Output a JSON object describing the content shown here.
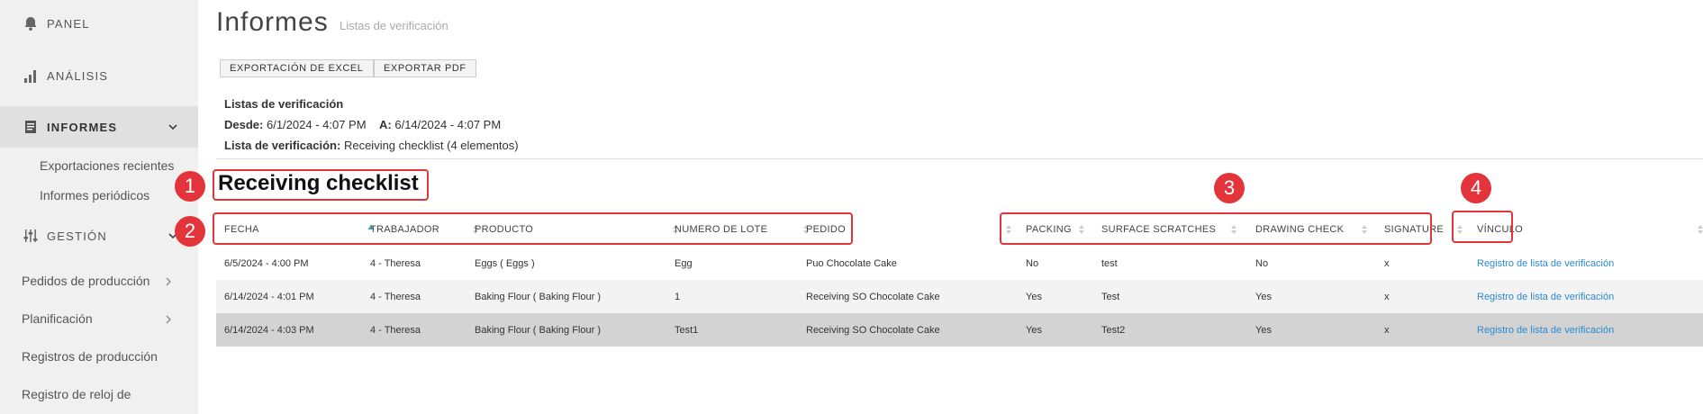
{
  "sidebar": {
    "nav": {
      "panel": "PANEL",
      "analisis": "ANÁLISIS",
      "informes": "INFORMES",
      "gestion": "GESTIÓN"
    },
    "informes_sub": [
      "Exportaciones recientes",
      "Informes periódicos"
    ],
    "gestion_sub": [
      "Pedidos de producción",
      "Planificación",
      "Registros de producción",
      "Registro de reloj de"
    ]
  },
  "header": {
    "title": "Informes",
    "subtitle": "Listas de verificación"
  },
  "toolbar": {
    "excel_label": "EXPORTACIÓN DE EXCEL",
    "pdf_label": "EXPORTAR PDF"
  },
  "report_meta": {
    "heading": "Listas de verificación",
    "desde_label": "Desde:",
    "desde_value": "6/1/2024 - 4:07 PM",
    "a_label": "A:",
    "a_value": "6/14/2024 - 4:07 PM",
    "list_label": "Lista de verificación:",
    "list_value": "Receiving checklist (4 elementos)"
  },
  "section_title": "Receiving checklist",
  "table": {
    "columns": [
      "FECHA",
      "TRABAJADOR",
      "PRODUCTO",
      "NUMERO DE LOTE",
      "PEDIDO",
      "PACKING",
      "SURFACE SCRATCHES",
      "DRAWING CHECK",
      "SIGNATURE",
      "VÍNCULO"
    ],
    "sorted_column": "FECHA",
    "sort_direction": "ascending",
    "rows": [
      [
        "6/5/2024 - 4:00 PM",
        "4 - Theresa",
        "Eggs ( Eggs )",
        "Egg",
        "Puo Chocolate Cake",
        "No",
        "test",
        "No",
        "x",
        "Registro de lista de verificación"
      ],
      [
        "6/14/2024 - 4:01 PM",
        "4 - Theresa",
        "Baking Flour ( Baking Flour )",
        "1",
        "Receiving SO Chocolate Cake",
        "Yes",
        "Test",
        "Yes",
        "x",
        "Registro de lista de verificación"
      ],
      [
        "6/14/2024 - 4:03 PM",
        "4 - Theresa",
        "Baking Flour ( Baking Flour )",
        "Test1",
        "Receiving SO Chocolate Cake",
        "Yes",
        "Test2",
        "Yes",
        "x",
        "Registro de lista de verificación"
      ]
    ],
    "selected_row_index": 2
  },
  "annotations": [
    "1",
    "2",
    "3",
    "4"
  ],
  "colors": {
    "annotation": "#e3343b",
    "link": "#2a8ad2",
    "sidebar_bg": "#f0f0f0",
    "selected_row": "#d3d3d3",
    "sort_active": "#3aa0a8"
  }
}
